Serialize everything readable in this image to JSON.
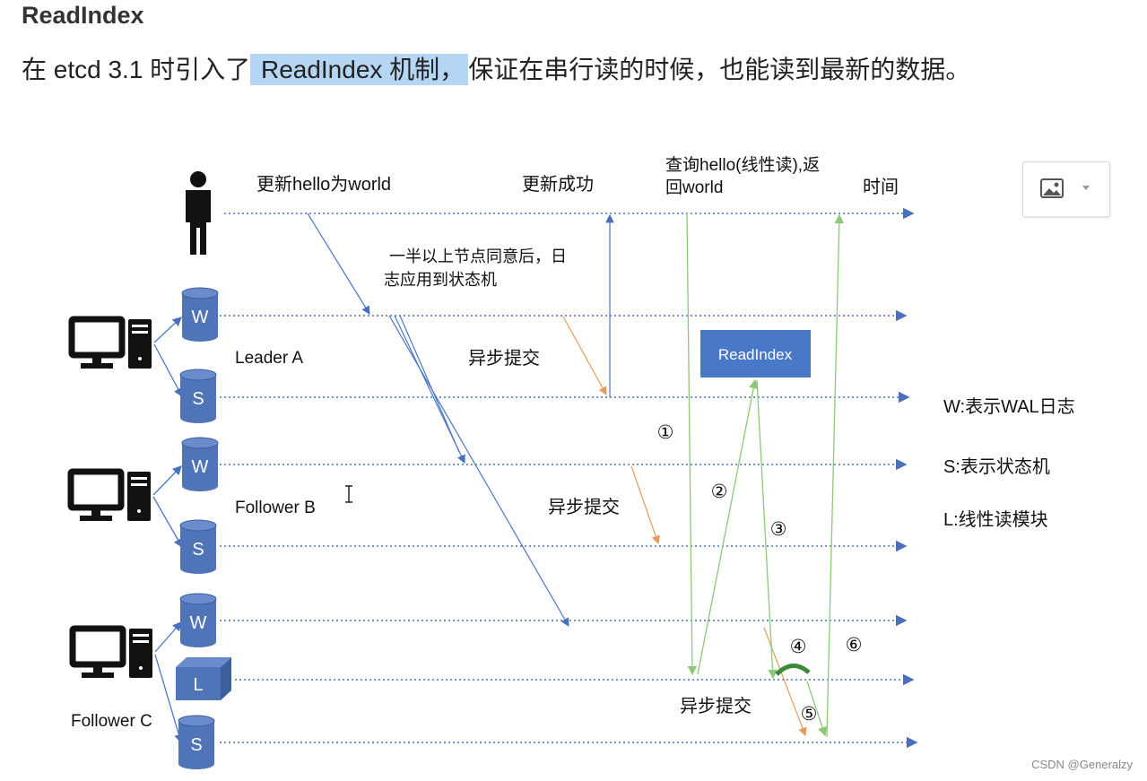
{
  "heading": "ReadIndex",
  "intro": {
    "prefix": "在 etcd 3.1 时引入了",
    "highlight": " ReadIndex 机制，",
    "suffix": "保证在串行读的时候，也能读到最新的数据。"
  },
  "diagram": {
    "top_labels": {
      "update": "更新hello为world",
      "success": "更新成功",
      "query_line1": "查询hello(线性读),返",
      "query_line2": "回world",
      "time": "时间"
    },
    "majority_note": {
      "line1": "一半以上节点同意后，日",
      "line2": "志应用到状态机"
    },
    "async_commit": "异步提交",
    "readindex_box": "ReadIndex",
    "nodes": {
      "leader": "Leader A",
      "follower_b": "Follower B",
      "follower_c": "Follower C"
    },
    "store_letters": {
      "wal": "W",
      "state": "S",
      "linear": "L"
    },
    "legend": {
      "w": "W:表示WAL日志",
      "s": "S:表示状态机",
      "l": "L:线性读模块"
    },
    "steps": [
      "①",
      "②",
      "③",
      "④",
      "⑤",
      "⑥"
    ],
    "colors": {
      "timeline": "#4a6fc0",
      "node_fill": "#4f74b8",
      "replication_arrow": "#4a78c8",
      "async_arrow": "#e89a60",
      "read_arrow": "#8cc878",
      "readindex_fill": "#4a78c8",
      "wait_arc": "#3b8a3a"
    }
  },
  "toolbar": {
    "image_button_icon": "image-icon",
    "caret_icon": "chevron-down-icon"
  },
  "watermark": "CSDN @Generalzy"
}
